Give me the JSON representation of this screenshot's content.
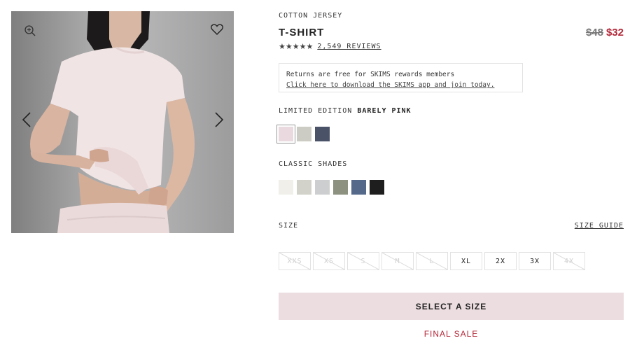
{
  "product": {
    "category": "COTTON JERSEY",
    "title": "T-SHIRT",
    "price_old": "$48",
    "price_new": "$32",
    "rating_stars": "★★★★★",
    "reviews": "2,549 REVIEWS"
  },
  "gallery": {
    "icons": [
      "zoom-in-icon",
      "heart-icon",
      "chevron-left-icon",
      "chevron-right-icon"
    ]
  },
  "promo": {
    "line1": "Returns are free for SKIMS rewards members",
    "link": "Click here to download the SKIMS app and join today."
  },
  "limited": {
    "label": "LIMITED EDITION",
    "selected_color": "BARELY PINK",
    "swatches": [
      {
        "name": "barely-pink",
        "color": "#eadadf",
        "selected": true
      },
      {
        "name": "sage",
        "color": "#ccccc4",
        "selected": false
      },
      {
        "name": "navy-slate",
        "color": "#4a5268",
        "selected": false
      }
    ]
  },
  "classic": {
    "label": "CLASSIC SHADES",
    "swatches": [
      {
        "name": "cream",
        "color": "#f0efea"
      },
      {
        "name": "light-sage",
        "color": "#d2d2ca"
      },
      {
        "name": "light-grey",
        "color": "#cdcecf"
      },
      {
        "name": "olive",
        "color": "#8c9180"
      },
      {
        "name": "slate-blue",
        "color": "#55698a"
      },
      {
        "name": "black",
        "color": "#1e1e1e"
      }
    ]
  },
  "size": {
    "label": "SIZE",
    "guide": "SIZE GUIDE",
    "options": [
      {
        "label": "XXS",
        "available": false
      },
      {
        "label": "XS",
        "available": false
      },
      {
        "label": "S",
        "available": false
      },
      {
        "label": "M",
        "available": false
      },
      {
        "label": "L",
        "available": false
      },
      {
        "label": "XL",
        "available": true
      },
      {
        "label": "2X",
        "available": true
      },
      {
        "label": "3X",
        "available": true
      },
      {
        "label": "4X",
        "available": false
      }
    ]
  },
  "cta": {
    "label": "SELECT A SIZE",
    "note": "FINAL SALE"
  }
}
